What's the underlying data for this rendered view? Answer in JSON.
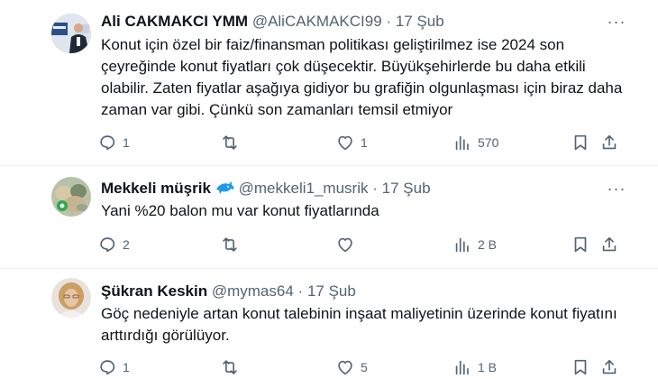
{
  "tweets": [
    {
      "name": "Ali CAKMAKCI YMM",
      "handle": "@AliCAKMAKCI99",
      "separator": "·",
      "date": "17 Şub",
      "text": "Konut için özel bir faiz/finansman politikası geliştirilmez ise 2024 son çeyreğinde konut fiyatları çok düşecektir. Büyükşehirlerde bu daha etkili olabilir. Zaten fiyatlar aşağıya gidiyor bu grafiğin olgunlaşması için biraz daha zaman var gibi. Çünkü son zamanları temsil etmiyor",
      "replies": "1",
      "retweets": "",
      "likes": "1",
      "views": "570"
    },
    {
      "name": "Mekkeli müşrik",
      "handle": "@mekkeli1_musrik",
      "separator": "·",
      "date": "17 Şub",
      "text": "Yani %20 balon mu var konut fiyatlarında",
      "replies": "2",
      "retweets": "",
      "likes": "",
      "views": "2 B"
    },
    {
      "name": "Şükran Keskin",
      "handle": "@mymas64",
      "separator": "·",
      "date": "17 Şub",
      "text": "Göç nedeniyle artan konut talebinin inşaat maliyetinin üzerinde konut fiyatını arttırdığı görülüyor.",
      "replies": "1",
      "retweets": "",
      "likes": "5",
      "views": "1 B"
    }
  ],
  "more_glyph": "···",
  "colors": {
    "text": "#0f1419",
    "secondary": "#536471",
    "divider": "#eff3f4",
    "badge": "#1d9bf0"
  },
  "icons": [
    "reply-icon",
    "retweet-icon",
    "like-icon",
    "views-icon",
    "bookmark-icon",
    "share-icon",
    "more-icon",
    "dolphin-badge-icon"
  ]
}
